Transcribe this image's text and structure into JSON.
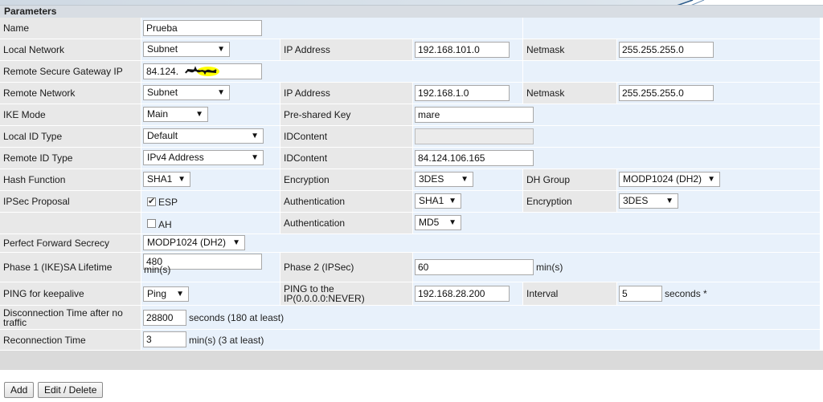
{
  "section_title": "Parameters",
  "rows": {
    "name": {
      "label": "Name",
      "value": "Prueba"
    },
    "local_network": {
      "label": "Local Network",
      "type_value": "Subnet",
      "ip_label": "IP Address",
      "ip_value": "192.168.101.0",
      "mask_label": "Netmask",
      "mask_value": "255.255.255.0"
    },
    "remote_gateway": {
      "label": "Remote Secure Gateway IP",
      "value": "84.124."
    },
    "remote_network": {
      "label": "Remote Network",
      "type_value": "Subnet",
      "ip_label": "IP Address",
      "ip_value": "192.168.1.0",
      "mask_label": "Netmask",
      "mask_value": "255.255.255.0"
    },
    "ike_mode": {
      "label": "IKE Mode",
      "value": "Main",
      "psk_label": "Pre-shared Key",
      "psk_value": "mare"
    },
    "local_id": {
      "label": "Local ID Type",
      "value": "Default",
      "content_label": "IDContent",
      "content_value": ""
    },
    "remote_id": {
      "label": "Remote ID Type",
      "value": "IPv4 Address",
      "content_label": "IDContent",
      "content_value": "84.124.106.165"
    },
    "hash": {
      "label": "Hash Function",
      "value": "SHA1",
      "enc_label": "Encryption",
      "enc_value": "3DES",
      "dh_label": "DH Group",
      "dh_value": "MODP1024 (DH2)"
    },
    "ipsec": {
      "label": "IPSec Proposal",
      "esp_label": "ESP",
      "auth_label": "Authentication",
      "auth_value": "SHA1",
      "enc_label": "Encryption",
      "enc_value": "3DES"
    },
    "ah": {
      "ah_label": "AH",
      "auth_label": "Authentication",
      "auth_value": "MD5"
    },
    "pfs": {
      "label": "Perfect Forward Secrecy",
      "value": "MODP1024 (DH2)"
    },
    "lifetime": {
      "label": "Phase 1 (IKE)SA Lifetime",
      "value": "480",
      "unit": "min(s)",
      "p2_label": "Phase 2 (IPSec)",
      "p2_value": "60",
      "p2_unit": "min(s)"
    },
    "ping": {
      "label": "PING for keepalive",
      "value": "Ping",
      "target_label": "PING to the IP(0.0.0.0:NEVER)",
      "target_value": "192.168.28.200",
      "interval_label": "Interval",
      "interval_value": "5",
      "interval_unit": "seconds *"
    },
    "disconnect": {
      "label": "Disconnection Time after no traffic",
      "value": "28800",
      "unit": "seconds (180 at least)"
    },
    "reconnect": {
      "label": "Reconnection Time",
      "value": "3",
      "unit": "min(s) (3 at least)"
    }
  },
  "buttons": {
    "add": "Add",
    "edit_delete": "Edit / Delete"
  },
  "colors": {
    "label_bg": "#e8e8e8",
    "value_bg": "#e8f1fb",
    "highlight": "#ffff00"
  }
}
